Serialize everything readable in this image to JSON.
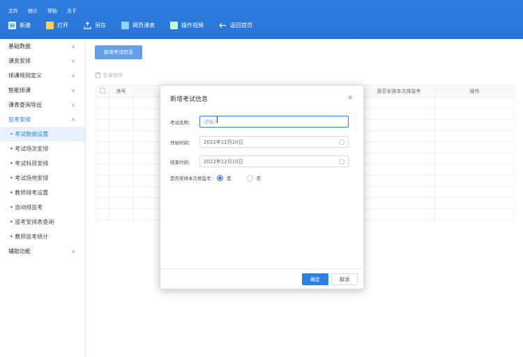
{
  "menubar": [
    "文件",
    "统计",
    "帮助",
    "关于"
  ],
  "toolbar": [
    {
      "label": "新建",
      "icon": "new-file-icon"
    },
    {
      "label": "打开",
      "icon": "folder-icon"
    },
    {
      "label": "另存",
      "icon": "save-as-icon"
    },
    {
      "label": "网页课表",
      "icon": "web-table-icon"
    },
    {
      "label": "操作视频",
      "icon": "video-icon"
    },
    {
      "label": "返回首页",
      "icon": "back-arrow-icon"
    }
  ],
  "sidebar": {
    "groups": [
      {
        "label": "基础数据",
        "chevron": "∨"
      },
      {
        "label": "课务安排",
        "chevron": "∨"
      },
      {
        "label": "排课规则定义",
        "chevron": "∨"
      },
      {
        "label": "智能排课",
        "chevron": "∨"
      },
      {
        "label": "课表查询导出",
        "chevron": "∨"
      },
      {
        "label": "监考安排",
        "chevron": "∧"
      }
    ],
    "sub_items": [
      "• 考试数据设置",
      "• 考试场次安排",
      "• 考试科目安排",
      "• 考试场地安排",
      "• 教师排考设置",
      "• 自动排监考",
      "• 监考安排表查询",
      "• 教师监考统计"
    ],
    "last_group": {
      "label": "辅助功能",
      "chevron": "∨"
    }
  },
  "main": {
    "add_button": "新增考试信息",
    "bulk_delete": "批量删除",
    "table_headers": {
      "index": "序号",
      "arrange": "是否安排本次排监考",
      "action": "操作"
    },
    "empty_rows": 11
  },
  "dialog": {
    "title": "新增考试信息",
    "close": "×",
    "fields": {
      "name_label": "考试名称：",
      "name_placeholder": "请输入",
      "start_label": "开始时间：",
      "start_value": "2022年12月10日",
      "end_label": "结束时间：",
      "end_value": "2022年12月10日",
      "arrange_label": "是否安排本次排监考：",
      "yes": "是",
      "no": "否"
    },
    "ok": "确定",
    "cancel": "取消"
  },
  "colors": {
    "primary": "#2f7fe0"
  }
}
